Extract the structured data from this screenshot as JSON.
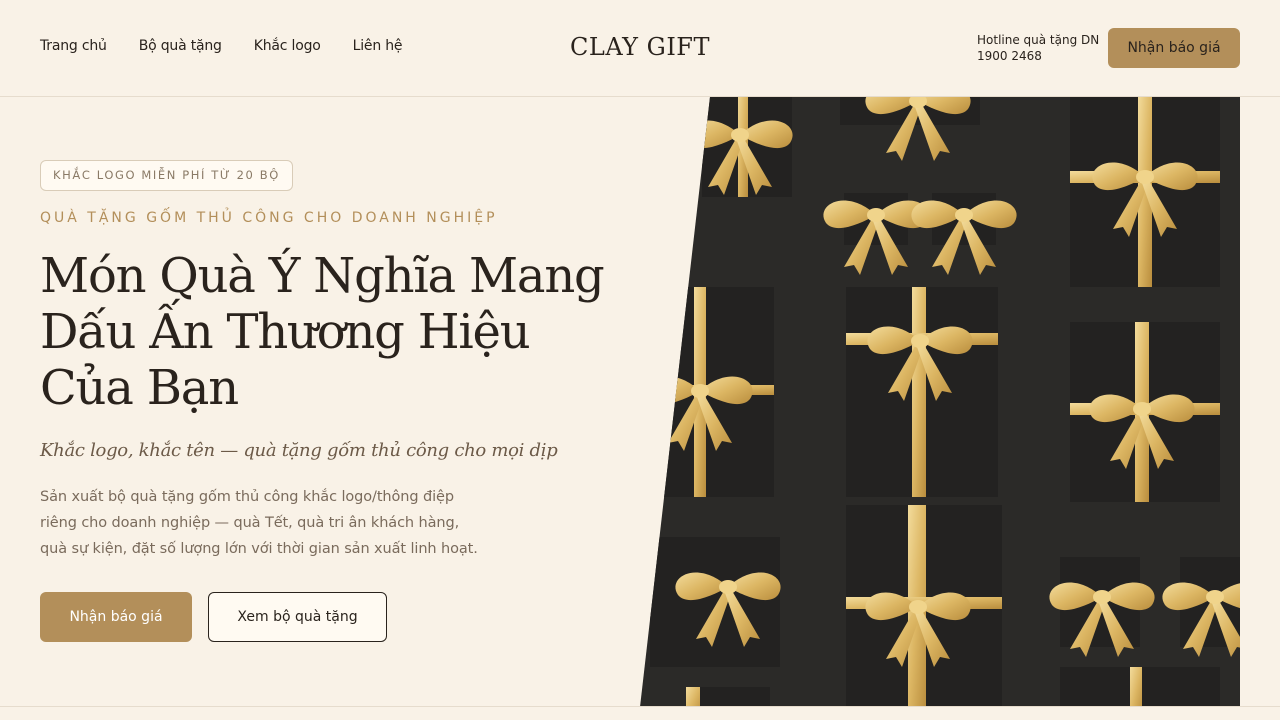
{
  "header": {
    "nav": [
      "Trang chủ",
      "Bộ quà tặng",
      "Khắc logo",
      "Liên hệ"
    ],
    "brand": "CLAY GIFT",
    "hotline_label": "Hotline quà tặng DN",
    "hotline_number": "1900 2468",
    "cta_label": "Nhận báo giá"
  },
  "hero": {
    "badge": "KHẮC LOGO MIỄN PHÍ TỪ 20 BỘ",
    "eyebrow": "QUÀ TẶNG GỐM THỦ CÔNG CHO DOANH NGHIỆP",
    "headline_lines": [
      "Món Quà Ý Nghĩa Mang",
      "Dấu Ấn Thương Hiệu",
      "Của Bạn"
    ],
    "tagline": "Khắc logo, khắc tên — quà tặng gốm thủ công cho mọi dịp",
    "description": "Sản xuất bộ quà tặng gốm thủ công khắc logo/thông điệp riêng cho doanh nghiệp — quà Tết, quà tri ân khách hàng, quà sự kiện, đặt số lượng lớn với thời gian sản xuất linh hoạt.",
    "primary_cta": "Nhận báo giá",
    "secondary_cta": "Xem bộ quà tặng"
  },
  "colors": {
    "background": "#f9f2e7",
    "accent": "#b38f5a",
    "text": "#2a231d",
    "gift_box": "#262524",
    "ribbon": "#e2c170"
  },
  "image": {
    "alt_icon": "gift-boxes-photo"
  }
}
